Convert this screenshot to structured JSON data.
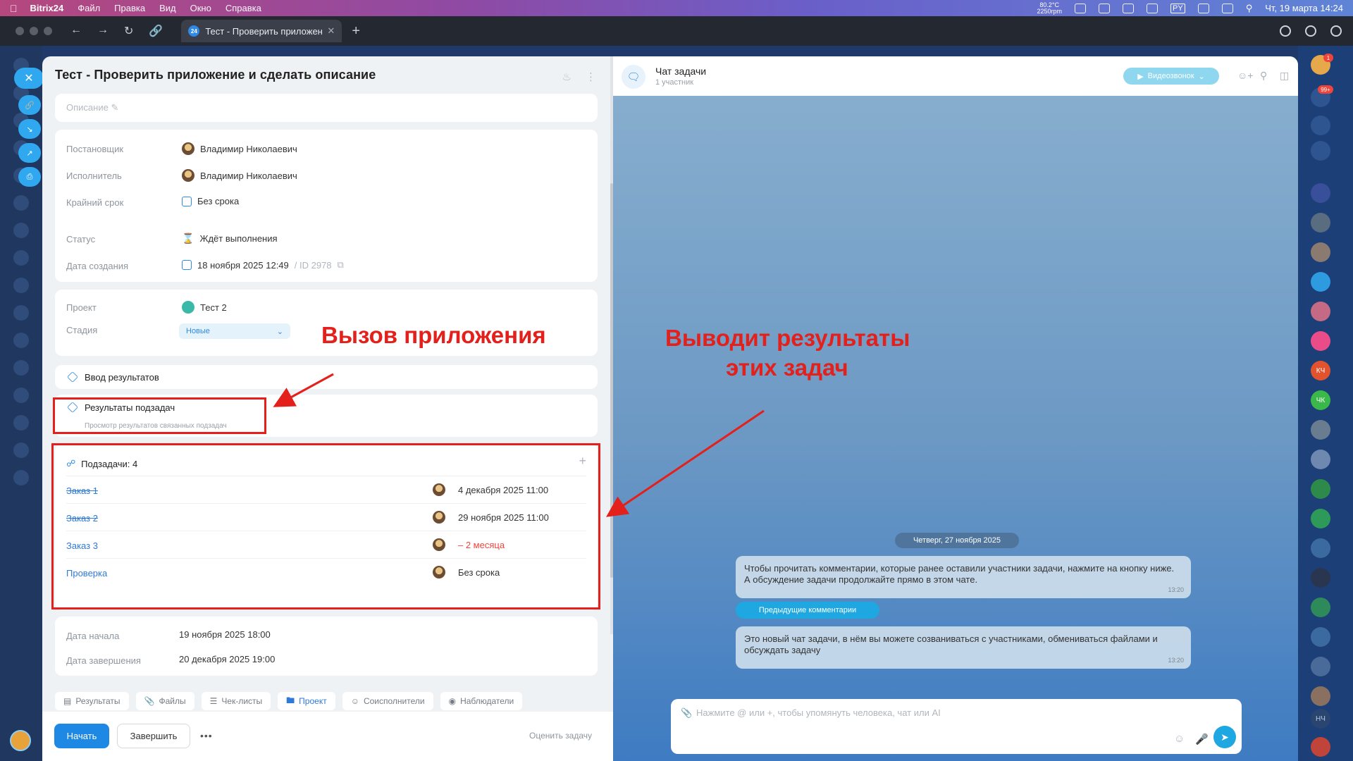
{
  "menubar": {
    "app": "Bitrix24",
    "items": [
      "Файл",
      "Правка",
      "Вид",
      "Окно",
      "Справка"
    ],
    "temp": "80.2°C",
    "rpm": "2250rpm",
    "lang": "PY",
    "datetime": "Чт, 19 марта  14:24"
  },
  "browser": {
    "tab_title": "Тест - Проверить приложен",
    "tab_favicon": "24"
  },
  "task": {
    "title": "Тест - Проверить приложение и сделать описание",
    "description_placeholder": "Описание",
    "fields": {
      "creator_label": "Постановщик",
      "creator_value": "Владимир Николаевич",
      "assignee_label": "Исполнитель",
      "assignee_value": "Владимир Николаевич",
      "deadline_label": "Крайний срок",
      "deadline_value": "Без срока",
      "status_label": "Статус",
      "status_value": "Ждёт выполнения",
      "created_label": "Дата создания",
      "created_value": "18 ноября 2025 12:49",
      "id_value": "/ ID 2978"
    },
    "project": {
      "project_label": "Проект",
      "project_value": "Тест 2",
      "stage_label": "Стадия",
      "stage_value": "Новые"
    },
    "apps": {
      "input_results": "Ввод результатов",
      "subtask_results": "Результаты подзадач",
      "subtask_results_sub": "Просмотр результатов связанных подзадач"
    },
    "subtasks": {
      "header": "Подзадачи: 4",
      "rows": [
        {
          "name": "Заказ 1",
          "date": "4 декабря 2025 11:00"
        },
        {
          "name": "Заказ 2",
          "date": "29 ноября 2025 11:00"
        },
        {
          "name": "Заказ 3",
          "date": "– 2 месяца"
        },
        {
          "name": "Проверка",
          "date": "Без срока"
        }
      ]
    },
    "dates": {
      "start_label": "Дата начала",
      "start_value": "19 ноября 2025 18:00",
      "end_label": "Дата завершения",
      "end_value": "20 декабря 2025 19:00"
    },
    "tabs": [
      "Результаты",
      "Файлы",
      "Чек-листы",
      "Проект",
      "Соисполнители",
      "Наблюдатели"
    ],
    "footer": {
      "start": "Начать",
      "finish": "Завершить",
      "more": "•••",
      "rate": "Оценить задачу"
    }
  },
  "chat": {
    "title": "Чат задачи",
    "participants": "1 участник",
    "video_call": "Видеозвонок",
    "date_divider": "Четверг, 27 ноября 2025",
    "message1": "Чтобы прочитать комментарии, которые ранее оставили участники задачи, нажмите на кнопку ниже. А обсуждение задачи продолжайте прямо в этом чате.",
    "message1_time": "13:20",
    "prev_comments": "Предыдущие комментарии",
    "message2": "Это новый чат задачи, в нём вы можете созваниваться с участниками, обмениваться файлами и обсуждать задачу",
    "message2_time": "13:20",
    "input_placeholder": "Нажмите @ или +, чтобы упомянуть человека, чат или AI"
  },
  "annotations": {
    "call_app": "Вызов приложения",
    "outputs_line1": "Выводит результаты",
    "outputs_line2": "этих задач"
  },
  "rail_badges": {
    "top": "1",
    "notif": "99+",
    "kch": "КЧ",
    "chk": "ЧК",
    "nch": "НЧ"
  },
  "colors": {
    "accent": "#1e88e5",
    "annotation_red": "#e3201b",
    "link_blue": "#2f7ad8"
  }
}
